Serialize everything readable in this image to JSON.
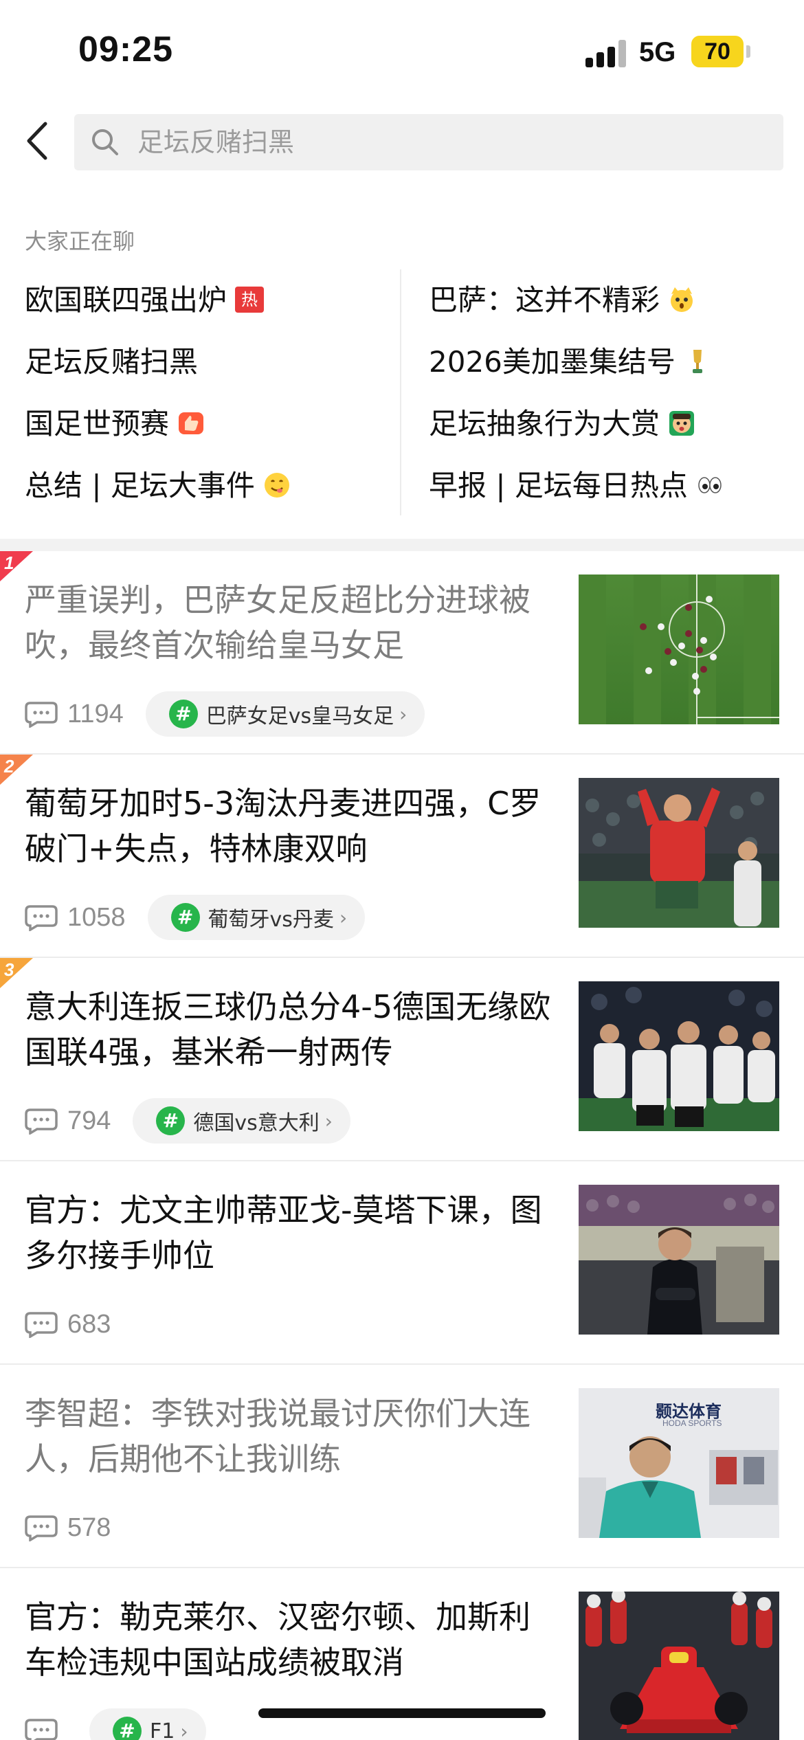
{
  "status_bar": {
    "time": "09:25",
    "network": "5G",
    "battery": "70"
  },
  "search": {
    "placeholder": "足坛反赌扫黑"
  },
  "trending": {
    "title": "大家正在聊",
    "left": [
      {
        "label": "欧国联四强出炉",
        "icon": "hot-badge-icon",
        "badge": "热"
      },
      {
        "label": "足坛反赌扫黑"
      },
      {
        "label": "国足世预赛",
        "icon": "thumbs-up-icon"
      },
      {
        "label": "总结 | 足坛大事件",
        "icon": "yum-face-icon"
      }
    ],
    "right": [
      {
        "label": "巴萨：这并不精彩",
        "icon": "shocked-cat-icon"
      },
      {
        "label": "2026美加墨集结号",
        "icon": "trophy-icon"
      },
      {
        "label": "足坛抽象行为大赏",
        "icon": "shocked-face-icon"
      },
      {
        "label": "早报 | 足坛每日热点",
        "icon": "eyes-icon"
      }
    ]
  },
  "news": [
    {
      "rank": "1",
      "rank_color": "#f03c4d",
      "title": "严重误判，巴萨女足反超比分进球被吹，最终首次输给皇马女足",
      "read": true,
      "comments": "1194",
      "tag": "巴萨女足vs皇马女足",
      "thumb": "soccer-pitch-aerial-image"
    },
    {
      "rank": "2",
      "rank_color": "#f5834b",
      "title": "葡萄牙加时5-3淘汰丹麦进四强，C罗破门+失点，特林康双响",
      "read": false,
      "comments": "1058",
      "tag": "葡萄牙vs丹麦",
      "thumb": "player-celebration-image"
    },
    {
      "rank": "3",
      "rank_color": "#f6a53b",
      "title": "意大利连扳三球仍总分4-5德国无缘欧国联4强，基米希一射两传",
      "read": false,
      "comments": "794",
      "tag": "德国vs意大利",
      "thumb": "team-celebration-image"
    },
    {
      "title": "官方：尤文主帅蒂亚戈-莫塔下课，图多尔接手帅位",
      "read": false,
      "comments": "683",
      "thumb": "coach-sideline-image"
    },
    {
      "title": "李智超：李铁对我说最讨厌你们大连人，后期他不让我训练",
      "read": true,
      "comments": "578",
      "thumb": "interview-image",
      "thumb_text": "颢达体育",
      "thumb_text_en": "HODA SPORTS"
    },
    {
      "title": "官方：勒克莱尔、汉密尔顿、加斯利车检违规中国站成绩被取消",
      "read": false,
      "comments": "",
      "tag": "F1",
      "thumb": "f1-car-image"
    }
  ]
}
